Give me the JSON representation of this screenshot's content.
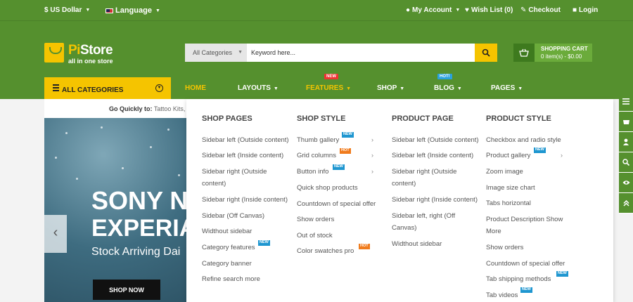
{
  "topbar": {
    "currency": "$ US Dollar",
    "language": "Language",
    "account": "My Account",
    "wishlist": "Wish List (0)",
    "checkout": "Checkout",
    "login": "Login"
  },
  "logo": {
    "pi": "Pi",
    "store": "Store",
    "tagline": "all in one store"
  },
  "search": {
    "category": "All Categories",
    "placeholder": "Keyword here..."
  },
  "cart": {
    "title": "SHOPPING CART",
    "summary": "0 item(s) - $0.00"
  },
  "nav": {
    "all_categories": "ALL CATEGORIES",
    "links": [
      "HOME",
      "LAYOUTS",
      "FEATURES",
      "SHOP",
      "BLOG",
      "PAGES"
    ],
    "badge_features": "NEW",
    "badge_blog": "HOT!"
  },
  "quick": {
    "label": "Go Quickly to:",
    "value": "Tattoo Kits,"
  },
  "banner": {
    "line1": "SONY N",
    "line2": "EXPERIA",
    "sub": "Stock Arriving Dai",
    "cta": "SHOP NOW",
    "prev": "‹"
  },
  "badges": {
    "new": "NEW",
    "hot": "HOT"
  },
  "mega": {
    "shop_pages": {
      "title": "SHOP PAGES",
      "items": [
        "Sidebar left (Outside content)",
        "Sidebar left (Inside content)",
        "Sidebar right (Outside",
        "content)",
        "Sidebar right (Inside content)",
        "Sidebar (Off Canvas)",
        "Widthout sidebar",
        "Category features",
        "Category banner",
        "Refine search more"
      ]
    },
    "shop_style": {
      "title": "SHOP STYLE",
      "items": [
        "Thumb gallery",
        "Grid columns",
        "Button info",
        "Quick shop products",
        "Countdown of special offer",
        "Show orders",
        "Out of stock",
        "Color swatches pro"
      ]
    },
    "product_page": {
      "title": "PRODUCT PAGE",
      "items": [
        "Sidebar left (Outside content)",
        "Sidebar left (Inside content)",
        "Sidebar right (Outside",
        "content)",
        "Sidebar right (Inside content)",
        "Sidebar left, right (Off",
        "Canvas)",
        "Widthout sidebar"
      ]
    },
    "product_style": {
      "title": "PRODUCT STYLE",
      "items": [
        "Checkbox and radio style",
        "Product gallery",
        "Zoom image",
        "Image size chart",
        "Tabs horizontal",
        "Product Description Show",
        "More",
        "Show orders",
        "Countdown of special offer",
        "Tab shipping methods",
        "Tab videos"
      ]
    }
  },
  "colors": {
    "brand_green": "#55902e",
    "accent_yellow": "#f5c400",
    "badge_new": "#1e96d0",
    "badge_hot": "#f07b1c"
  }
}
